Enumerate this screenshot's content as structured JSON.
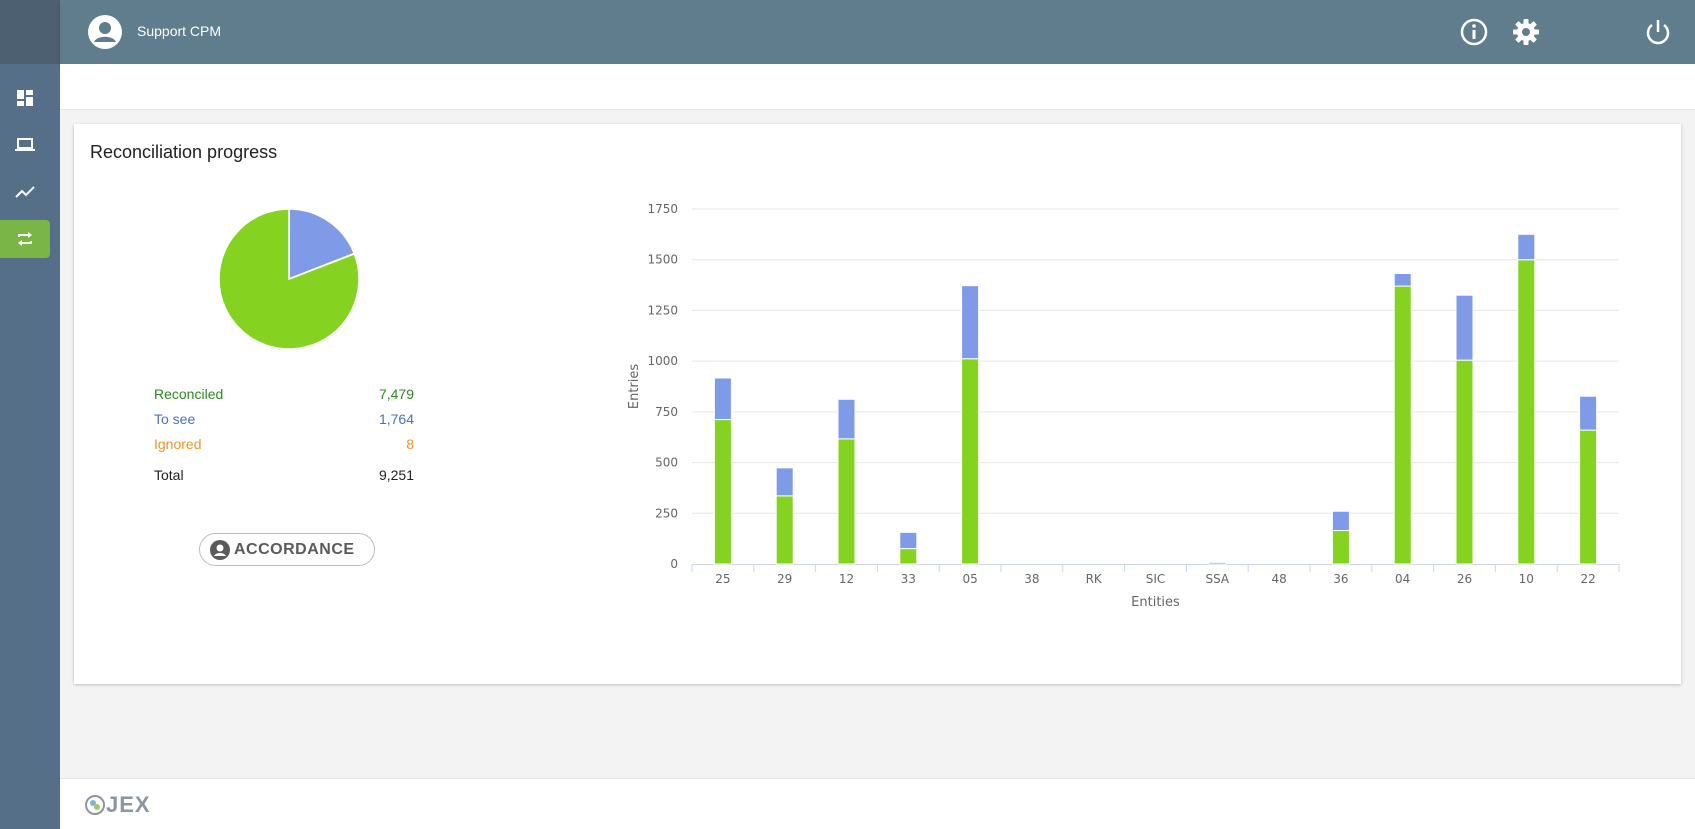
{
  "header": {
    "user_name": "Support CPM"
  },
  "sidebar": {
    "items": [
      {
        "icon": "dashboard-icon"
      },
      {
        "icon": "laptop-icon"
      },
      {
        "icon": "trending-icon"
      },
      {
        "icon": "repeat-icon",
        "active": true
      }
    ]
  },
  "card": {
    "title": "Reconciliation progress"
  },
  "summary": {
    "reconciled_label": "Reconciled",
    "reconciled_value": "7,479",
    "tosee_label": "To see",
    "tosee_value": "1,764",
    "ignored_label": "Ignored",
    "ignored_value": "8",
    "total_label": "Total",
    "total_value": "9,251"
  },
  "badge": {
    "text": "ACCORDANCE"
  },
  "footer": {
    "logo_text": "JEX"
  },
  "colors": {
    "reconciled": "#86d221",
    "tosee": "#7f9be8",
    "ignored": "#f7a35c"
  },
  "chart_data": [
    {
      "type": "pie",
      "slices": [
        {
          "name": "Reconciled",
          "value": 7479
        },
        {
          "name": "To see",
          "value": 1764
        },
        {
          "name": "Ignored",
          "value": 8
        }
      ]
    },
    {
      "type": "bar",
      "stacked": true,
      "xlabel": "Entities",
      "ylabel": "Entries",
      "ylim": [
        0,
        1750
      ],
      "yticks": [
        0,
        250,
        500,
        750,
        1000,
        1250,
        1500,
        1750
      ],
      "categories": [
        "25",
        "29",
        "12",
        "33",
        "05",
        "38",
        "RK",
        "SIC",
        "SSA",
        "48",
        "36",
        "04",
        "26",
        "10",
        "22"
      ],
      "series": [
        {
          "name": "Reconciled",
          "values": [
            712,
            336,
            617,
            76,
            1012,
            0,
            0,
            0,
            0,
            0,
            165,
            1370,
            1005,
            1500,
            660
          ]
        },
        {
          "name": "To see",
          "values": [
            205,
            138,
            195,
            80,
            360,
            0,
            0,
            0,
            8,
            0,
            95,
            62,
            320,
            125,
            167
          ]
        },
        {
          "name": "Ignored",
          "values": [
            0,
            0,
            0,
            0,
            0,
            0,
            0,
            0,
            0,
            0,
            0,
            0,
            0,
            0,
            0
          ]
        }
      ],
      "legend": "bottom-center",
      "grid": true
    }
  ]
}
